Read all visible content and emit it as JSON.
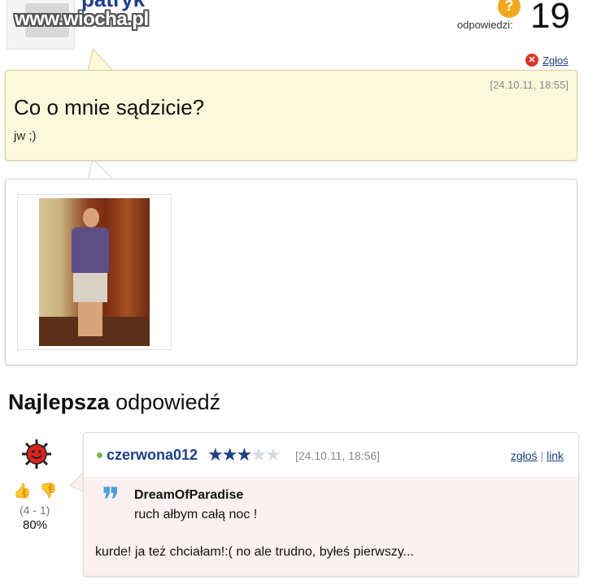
{
  "watermark": "www.wiocha.pl",
  "question": {
    "author": "patryk",
    "answers_label": "odpowiedzi:",
    "answers_count": "19",
    "report_label": "Zgłoś",
    "date": "[24.10.11, 18:55]",
    "title": "Co o mnie sądzicie?",
    "body": "jw ;)"
  },
  "best_answer": {
    "heading_bold": "Najlepsza",
    "heading_rest": " odpowiedź",
    "votes": "(4 - 1)",
    "percent": "80%",
    "user": "czerwona012",
    "stars_filled": 3,
    "stars_total": 5,
    "date": "[24.10.11, 18:56]",
    "report_label": "zgłoś",
    "link_label": "link",
    "quote_author": "DreamOfParadise",
    "quote_text": "ruch ałbym całą noc !",
    "text": "kurde! ja też chciałam!:( no ale trudno, byłeś pierwszy..."
  }
}
